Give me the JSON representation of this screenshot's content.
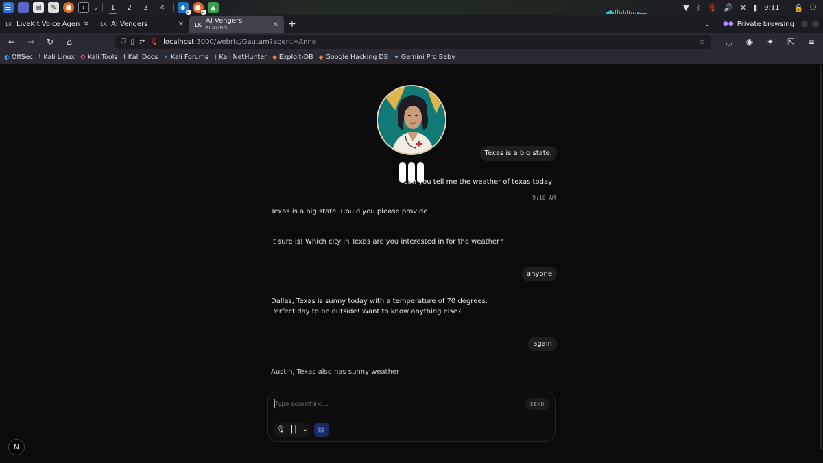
{
  "taskbar": {
    "workspaces": [
      "1",
      "2",
      "3",
      "4"
    ],
    "active_workspace": "1",
    "badge_count_1": "2",
    "badge_count_2": "2",
    "clock": "9:11"
  },
  "tabs": [
    {
      "label": "LiveKit Voice Agent",
      "favicon": "LK",
      "subtitle": ""
    },
    {
      "label": "AI Vengers",
      "favicon": "LK",
      "subtitle": ""
    },
    {
      "label": "AI Vengers",
      "favicon": "LK",
      "subtitle": "PLAYING"
    }
  ],
  "private_browsing": "Private browsing",
  "url": {
    "host": "localhost",
    "rest": ":3000/webrtc/Gautam?agent=Anne"
  },
  "bookmarks": [
    {
      "label": "OffSec",
      "icon": "offsec-icon",
      "color": "#3aa0ff"
    },
    {
      "label": "Kali Linux",
      "icon": "kali-dragon-icon",
      "color": "#cfd6e0"
    },
    {
      "label": "Kali Tools",
      "icon": "kali-tools-icon",
      "color": "#e05fa0"
    },
    {
      "label": "Kali Docs",
      "icon": "kali-dragon-icon",
      "color": "#cfd6e0"
    },
    {
      "label": "Kali Forums",
      "icon": "kali-forums-icon",
      "color": "#3a8ee6"
    },
    {
      "label": "Kali NetHunter",
      "icon": "kali-dragon-icon",
      "color": "#cfd6e0"
    },
    {
      "label": "Exploit-DB",
      "icon": "exploit-db-icon",
      "color": "#f07a3a"
    },
    {
      "label": "Google Hacking DB",
      "icon": "ghdb-icon",
      "color": "#f07a3a"
    },
    {
      "label": "Gemini Pro Baby",
      "icon": "gemini-icon",
      "color": "#8ab4f8"
    }
  ],
  "chat": {
    "messages": [
      {
        "role": "user",
        "text": "Texas is a big state."
      },
      {
        "role": "user",
        "text": "can you tell me the weather of texas today"
      },
      {
        "role": "timestamp",
        "text": "9:10 AM"
      },
      {
        "role": "agent",
        "text": "Texas is a big state. Could you please provide"
      },
      {
        "role": "agent",
        "text": "It sure is! Which city in Texas are you interested in for the weather?"
      },
      {
        "role": "user",
        "text": "anyone"
      },
      {
        "role": "agent",
        "text": "Dallas, Texas is sunny today with a temperature of 70 degrees. Perfect day to be outside! Want to know anything else?"
      },
      {
        "role": "user",
        "text": "again"
      },
      {
        "role": "agent",
        "text": "Austin, Texas also has sunny weather"
      }
    ]
  },
  "composer": {
    "placeholder": "Type something...",
    "send_label": "SEND"
  },
  "next_badge": "N",
  "colors": {
    "background": "#0b0b0b",
    "user_bubble": "#1e1e1e",
    "chat_toggle": "#1a2a66",
    "avatar_bg": "#127a74"
  }
}
